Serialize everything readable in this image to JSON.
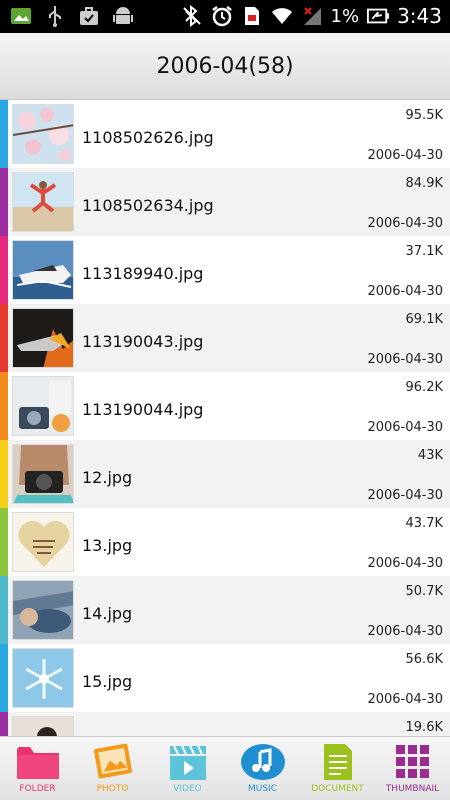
{
  "status_bar": {
    "battery_percent": "1%",
    "time": "3:43",
    "icons_left": [
      "gallery-icon",
      "usb-icon",
      "briefcase-icon",
      "android-icon"
    ],
    "icons_right": [
      "bluetooth-off-icon",
      "alarm-icon",
      "sd-card-icon",
      "wifi-icon",
      "signal-no-service-icon",
      "battery-charging-icon"
    ]
  },
  "header": {
    "title": "2006-04(58)"
  },
  "files": [
    {
      "name": "1108502626.jpg",
      "size": "95.5K",
      "date": "2006-04-30",
      "stripe": "#2aa6e0"
    },
    {
      "name": "1108502634.jpg",
      "size": "84.9K",
      "date": "2006-04-30",
      "stripe": "#9b2fa2"
    },
    {
      "name": "113189940.jpg",
      "size": "37.1K",
      "date": "2006-04-30",
      "stripe": "#e52a7d"
    },
    {
      "name": "113190043.jpg",
      "size": "69.1K",
      "date": "2006-04-30",
      "stripe": "#e5382e"
    },
    {
      "name": "113190044.jpg",
      "size": "96.2K",
      "date": "2006-04-30",
      "stripe": "#f28c1e"
    },
    {
      "name": "12.jpg",
      "size": "43K",
      "date": "2006-04-30",
      "stripe": "#f6cf16"
    },
    {
      "name": "13.jpg",
      "size": "43.7K",
      "date": "2006-04-30",
      "stripe": "#8cc63f"
    },
    {
      "name": "14.jpg",
      "size": "50.7K",
      "date": "2006-04-30",
      "stripe": "#4db8c9"
    },
    {
      "name": "15.jpg",
      "size": "56.6K",
      "date": "2006-04-30",
      "stripe": "#2aa6e0"
    },
    {
      "name": "",
      "size": "19.6K",
      "date": "",
      "stripe": "#9b2fa2"
    }
  ],
  "toolbar": {
    "tabs": [
      {
        "label": "FOLDER",
        "icon": "folder-icon",
        "color": "#e8336f"
      },
      {
        "label": "PHOTO",
        "icon": "photo-icon",
        "color": "#f39a1b"
      },
      {
        "label": "VIDEO",
        "icon": "video-icon",
        "color": "#5cc3d8"
      },
      {
        "label": "MUSIC",
        "icon": "music-icon",
        "color": "#1f8fd1"
      },
      {
        "label": "DOCUMENT",
        "icon": "document-icon",
        "color": "#9bc21c"
      },
      {
        "label": "THUMBNAIL",
        "icon": "thumbnail-icon",
        "color": "#9a2b8f"
      }
    ]
  }
}
